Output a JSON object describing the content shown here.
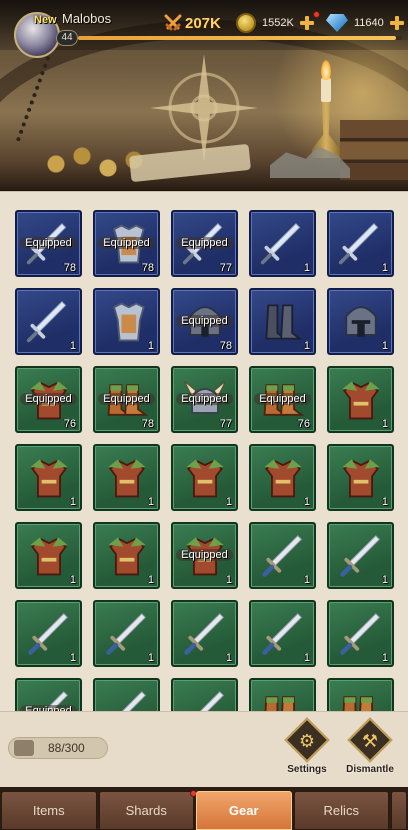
{
  "header": {
    "new_label": "New",
    "player_name": "Malobos",
    "level": "44",
    "xp_fraction": 0.98,
    "power": "207K",
    "gold": "1552K",
    "gems": "11640"
  },
  "inventory": {
    "equipped_label": "Equipped",
    "rows": [
      [
        {
          "rarity": "blue",
          "item": "sword",
          "level": "78",
          "equipped": true
        },
        {
          "rarity": "blue",
          "item": "armor",
          "level": "78",
          "equipped": true
        },
        {
          "rarity": "blue",
          "item": "sword",
          "level": "77",
          "equipped": true
        },
        {
          "rarity": "blue",
          "item": "sword",
          "level": "1",
          "equipped": false
        },
        {
          "rarity": "blue",
          "item": "sword",
          "level": "1",
          "equipped": false
        }
      ],
      [
        {
          "rarity": "blue",
          "item": "sword",
          "level": "1",
          "equipped": false
        },
        {
          "rarity": "blue",
          "item": "armor",
          "level": "1",
          "equipped": false
        },
        {
          "rarity": "blue",
          "item": "helmet",
          "level": "78",
          "equipped": true
        },
        {
          "rarity": "blue",
          "item": "boots",
          "level": "1",
          "equipped": false
        },
        {
          "rarity": "blue",
          "item": "helmet",
          "level": "1",
          "equipped": false
        }
      ],
      [
        {
          "rarity": "green",
          "item": "leather-armor",
          "level": "76",
          "equipped": true
        },
        {
          "rarity": "green",
          "item": "leather-boots",
          "level": "78",
          "equipped": true
        },
        {
          "rarity": "green",
          "item": "horned-helmet",
          "level": "77",
          "equipped": true
        },
        {
          "rarity": "green",
          "item": "leather-boots",
          "level": "76",
          "equipped": true
        },
        {
          "rarity": "green",
          "item": "leather-armor",
          "level": "1",
          "equipped": false
        }
      ],
      [
        {
          "rarity": "green",
          "item": "leather-armor",
          "level": "1",
          "equipped": false
        },
        {
          "rarity": "green",
          "item": "leather-armor",
          "level": "1",
          "equipped": false
        },
        {
          "rarity": "green",
          "item": "leather-armor",
          "level": "1",
          "equipped": false
        },
        {
          "rarity": "green",
          "item": "leather-armor",
          "level": "1",
          "equipped": false
        },
        {
          "rarity": "green",
          "item": "leather-armor",
          "level": "1",
          "equipped": false
        }
      ],
      [
        {
          "rarity": "green",
          "item": "leather-armor",
          "level": "1",
          "equipped": false
        },
        {
          "rarity": "green",
          "item": "leather-armor",
          "level": "1",
          "equipped": false
        },
        {
          "rarity": "green",
          "item": "leather-armor",
          "level": "1",
          "equipped": true
        },
        {
          "rarity": "green",
          "item": "sword-green",
          "level": "1",
          "equipped": false
        },
        {
          "rarity": "green",
          "item": "sword-green",
          "level": "1",
          "equipped": false
        }
      ],
      [
        {
          "rarity": "green",
          "item": "sword-green",
          "level": "1",
          "equipped": false
        },
        {
          "rarity": "green",
          "item": "sword-green",
          "level": "1",
          "equipped": false
        },
        {
          "rarity": "green",
          "item": "sword-green",
          "level": "1",
          "equipped": false
        },
        {
          "rarity": "green",
          "item": "sword-green",
          "level": "1",
          "equipped": false
        },
        {
          "rarity": "green",
          "item": "sword-green",
          "level": "1",
          "equipped": false
        }
      ],
      [
        {
          "rarity": "green",
          "item": "sword-green",
          "level": "",
          "equipped": true
        },
        {
          "rarity": "green",
          "item": "sword-green",
          "level": "",
          "equipped": false
        },
        {
          "rarity": "green",
          "item": "sword-green",
          "level": "",
          "equipped": false
        },
        {
          "rarity": "green",
          "item": "leather-boots",
          "level": "",
          "equipped": false
        },
        {
          "rarity": "green",
          "item": "leather-boots",
          "level": "",
          "equipped": false
        }
      ]
    ]
  },
  "footer": {
    "capacity": "88/300",
    "settings_label": "Settings",
    "dismantle_label": "Dismantle"
  },
  "tabs": [
    {
      "label": "Items",
      "active": false
    },
    {
      "label": "Shards",
      "active": false
    },
    {
      "label": "Gear",
      "active": true
    },
    {
      "label": "Relics",
      "active": false
    }
  ],
  "colors": {
    "accent_gold": "#f5c35b",
    "active_tab": "#e58a4a",
    "rarity_blue": "#2a3d7a",
    "rarity_green": "#2f6b45"
  }
}
